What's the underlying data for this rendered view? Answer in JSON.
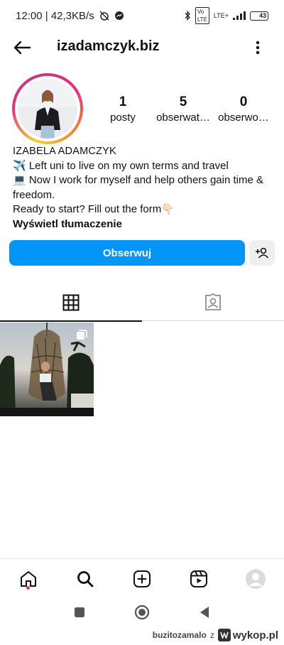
{
  "status_bar": {
    "time_speed": "12:00 | 42,3KB/s",
    "network": "LTE+",
    "battery": "43",
    "battery_level": 0.43
  },
  "header": {
    "username": "izadamczyk.biz"
  },
  "profile": {
    "stats": [
      {
        "value": "1",
        "label": "posty"
      },
      {
        "value": "5",
        "label": "obserwat…"
      },
      {
        "value": "0",
        "label": "obserwo…"
      }
    ],
    "name": "IZABELA ADAMCZYK",
    "bio_lines": [
      "✈️ Left uni to live on my own terms and travel",
      "💻 Now I work for myself and help others gain time & freedom.",
      "Ready to start? Fill out the form👇🏻"
    ],
    "translate_label": "Wyświetl tłumaczenie",
    "follow_label": "Obserwuj"
  },
  "tabs": [
    {
      "icon": "grid-icon",
      "active": true
    },
    {
      "icon": "tagged-icon",
      "active": false
    }
  ],
  "bottom_nav": [
    {
      "icon": "home-icon"
    },
    {
      "icon": "search-icon"
    },
    {
      "icon": "create-icon"
    },
    {
      "icon": "reels-icon"
    },
    {
      "icon": "profile-avatar-icon"
    }
  ],
  "watermark": {
    "user": "buzitozamalo",
    "z": "z",
    "site": "wykop.pl"
  },
  "colors": {
    "follow_button": "#0095f6",
    "notification_dot": "#ff3040"
  }
}
